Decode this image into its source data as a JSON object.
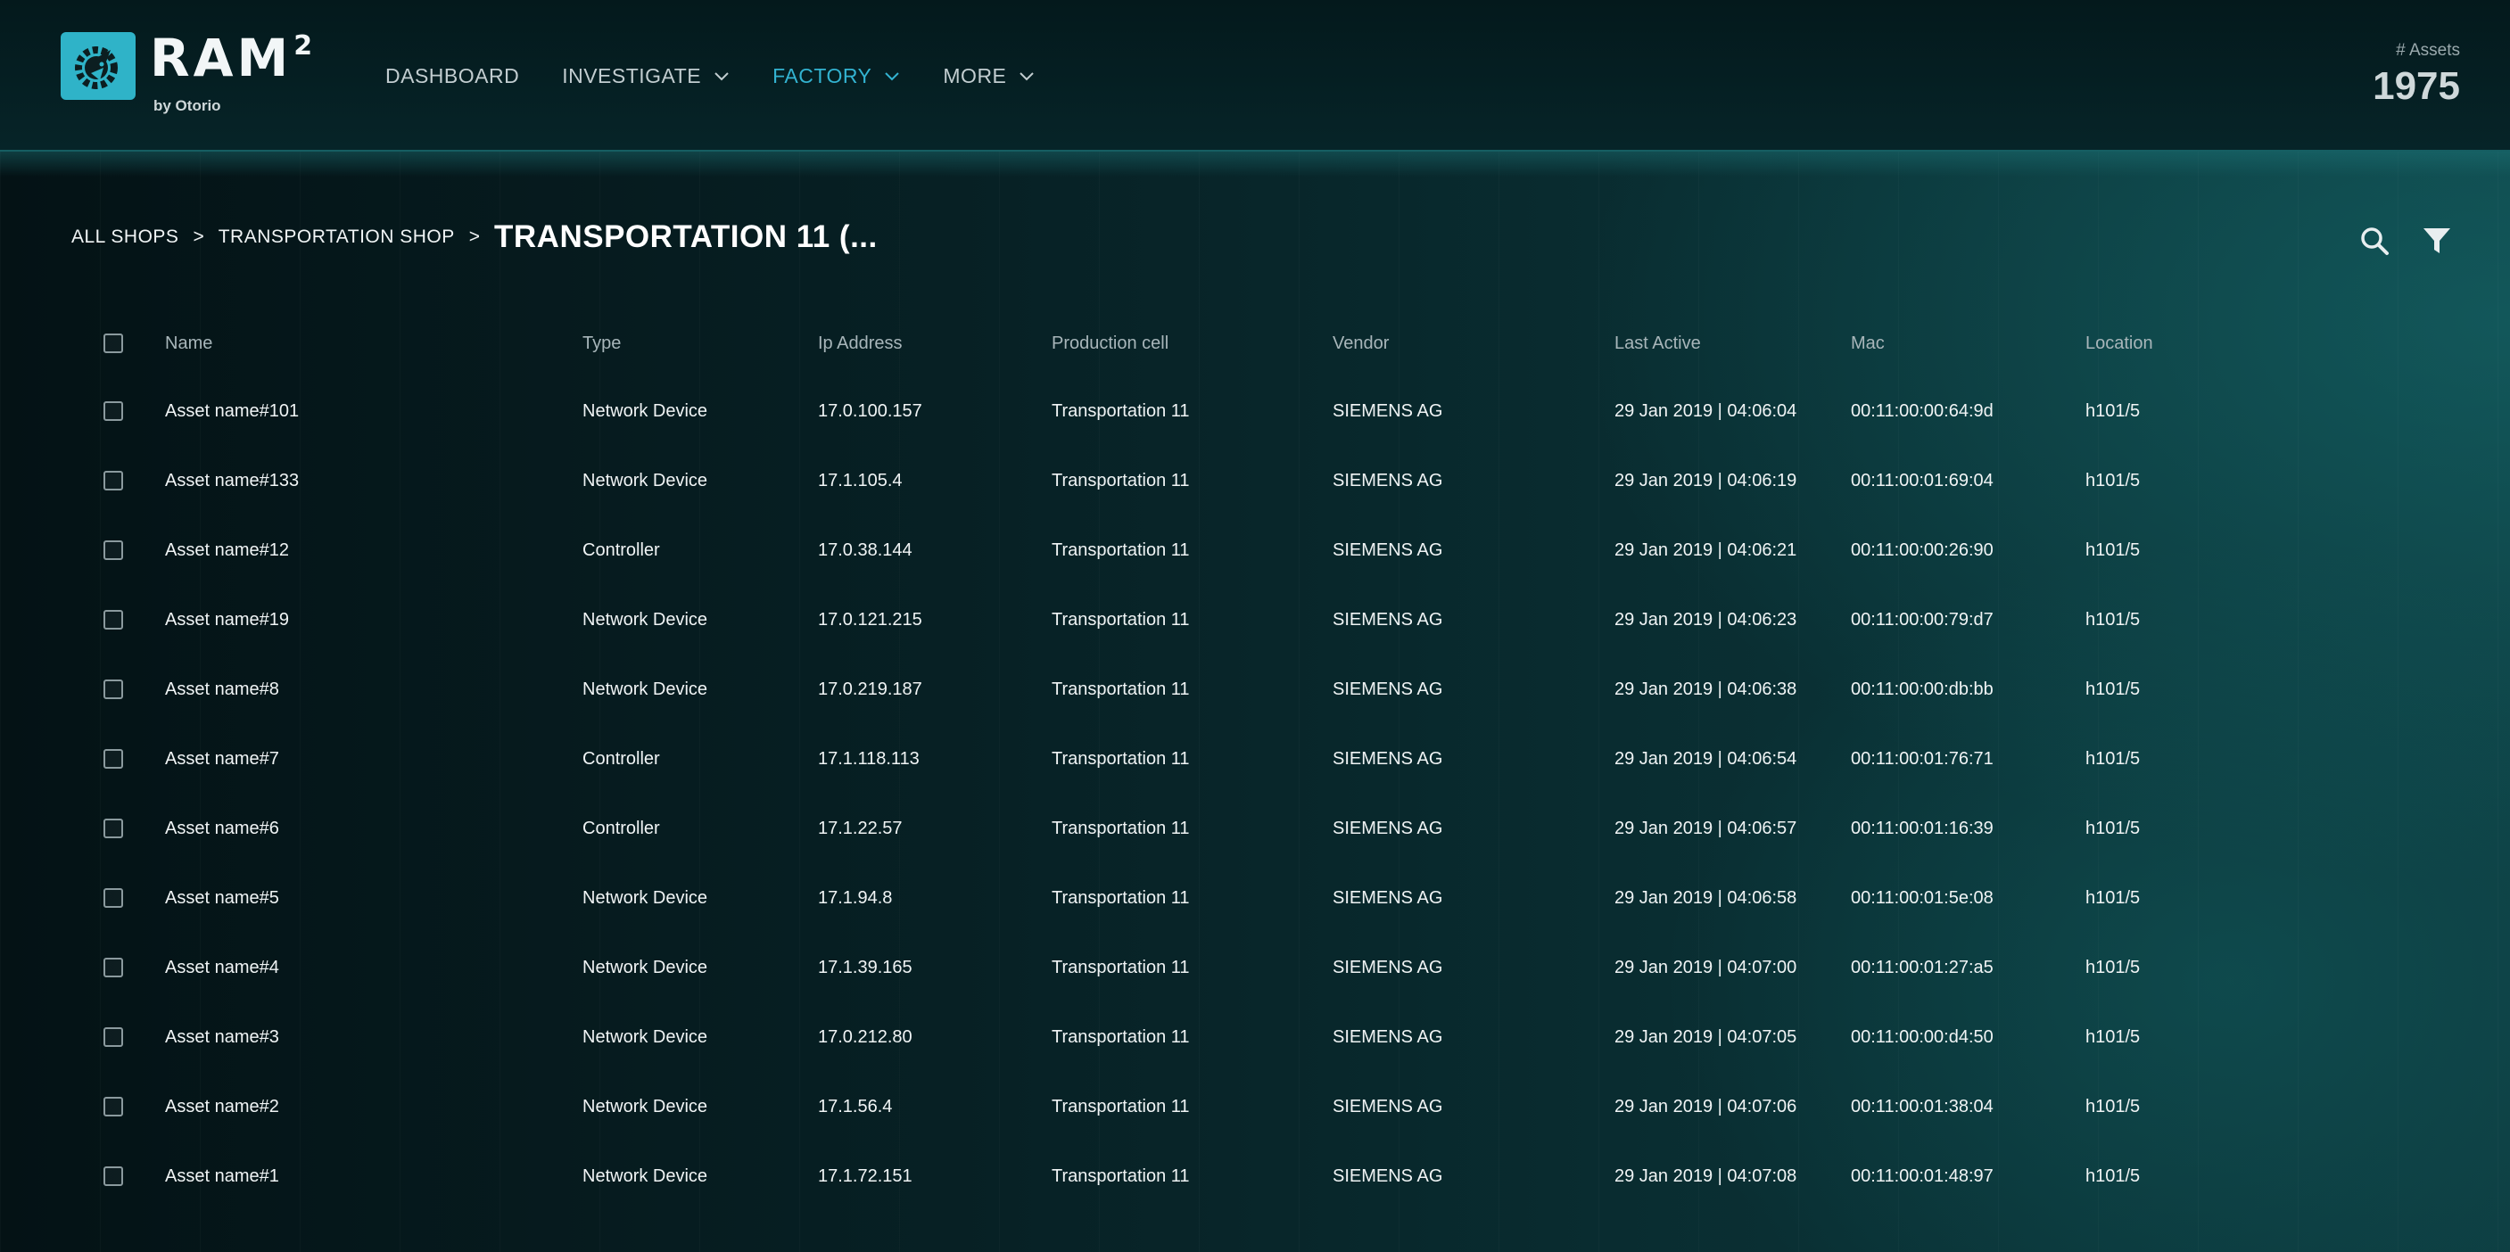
{
  "brand": {
    "name": "RAM",
    "superscript": "2",
    "tagline": "by Otorio"
  },
  "nav": {
    "items": [
      {
        "label": "DASHBOARD"
      },
      {
        "label": "INVESTIGATE"
      },
      {
        "label": "FACTORY"
      },
      {
        "label": "MORE"
      }
    ],
    "active": "FACTORY",
    "active_color": "#33b3d1"
  },
  "assets": {
    "label": "# Assets",
    "count": "1975"
  },
  "breadcrumb": {
    "items": [
      "ALL SHOPS",
      "TRANSPORTATION SHOP"
    ],
    "separator": ">",
    "current": "TRANSPORTATION 11 (..."
  },
  "toolbar": {
    "search_icon": "search-icon",
    "filter_icon": "filter-icon"
  },
  "table": {
    "columns": [
      "Name",
      "Type",
      "Ip Address",
      "Production cell",
      "Vendor",
      "Last Active",
      "Mac",
      "Location"
    ],
    "rows": [
      {
        "name": "Asset name#101",
        "type": "Network Device",
        "ip": "17.0.100.157",
        "cell": "Transportation 11",
        "vendor": "SIEMENS AG",
        "last_active": "29 Jan 2019 | 04:06:04",
        "mac": "00:11:00:00:64:9d",
        "location": "h101/5"
      },
      {
        "name": "Asset name#133",
        "type": "Network Device",
        "ip": "17.1.105.4",
        "cell": "Transportation 11",
        "vendor": "SIEMENS AG",
        "last_active": "29 Jan 2019 | 04:06:19",
        "mac": "00:11:00:01:69:04",
        "location": "h101/5"
      },
      {
        "name": "Asset name#12",
        "type": "Controller",
        "ip": "17.0.38.144",
        "cell": "Transportation 11",
        "vendor": "SIEMENS AG",
        "last_active": "29 Jan 2019 | 04:06:21",
        "mac": "00:11:00:00:26:90",
        "location": "h101/5"
      },
      {
        "name": "Asset name#19",
        "type": "Network Device",
        "ip": "17.0.121.215",
        "cell": "Transportation 11",
        "vendor": "SIEMENS AG",
        "last_active": "29 Jan 2019 | 04:06:23",
        "mac": "00:11:00:00:79:d7",
        "location": "h101/5"
      },
      {
        "name": "Asset name#8",
        "type": "Network Device",
        "ip": "17.0.219.187",
        "cell": "Transportation 11",
        "vendor": "SIEMENS AG",
        "last_active": "29 Jan 2019 | 04:06:38",
        "mac": "00:11:00:00:db:bb",
        "location": "h101/5"
      },
      {
        "name": "Asset name#7",
        "type": "Controller",
        "ip": "17.1.118.113",
        "cell": "Transportation 11",
        "vendor": "SIEMENS AG",
        "last_active": "29 Jan 2019 | 04:06:54",
        "mac": "00:11:00:01:76:71",
        "location": "h101/5"
      },
      {
        "name": "Asset name#6",
        "type": "Controller",
        "ip": "17.1.22.57",
        "cell": "Transportation 11",
        "vendor": "SIEMENS AG",
        "last_active": "29 Jan 2019 | 04:06:57",
        "mac": "00:11:00:01:16:39",
        "location": "h101/5"
      },
      {
        "name": "Asset name#5",
        "type": "Network Device",
        "ip": "17.1.94.8",
        "cell": "Transportation 11",
        "vendor": "SIEMENS AG",
        "last_active": "29 Jan 2019 | 04:06:58",
        "mac": "00:11:00:01:5e:08",
        "location": "h101/5"
      },
      {
        "name": "Asset name#4",
        "type": "Network Device",
        "ip": "17.1.39.165",
        "cell": "Transportation 11",
        "vendor": "SIEMENS AG",
        "last_active": "29 Jan 2019 | 04:07:00",
        "mac": "00:11:00:01:27:a5",
        "location": "h101/5"
      },
      {
        "name": "Asset name#3",
        "type": "Network Device",
        "ip": "17.0.212.80",
        "cell": "Transportation 11",
        "vendor": "SIEMENS AG",
        "last_active": "29 Jan 2019 | 04:07:05",
        "mac": "00:11:00:00:d4:50",
        "location": "h101/5"
      },
      {
        "name": "Asset name#2",
        "type": "Network Device",
        "ip": "17.1.56.4",
        "cell": "Transportation 11",
        "vendor": "SIEMENS AG",
        "last_active": "29 Jan 2019 | 04:07:06",
        "mac": "00:11:00:01:38:04",
        "location": "h101/5"
      },
      {
        "name": "Asset name#1",
        "type": "Network Device",
        "ip": "17.1.72.151",
        "cell": "Transportation 11",
        "vendor": "SIEMENS AG",
        "last_active": "29 Jan 2019 | 04:07:08",
        "mac": "00:11:00:01:48:97",
        "location": "h101/5"
      }
    ]
  },
  "colors": {
    "accent": "#33b3d1",
    "logo_bg": "#2fb3c8",
    "background": "#06191c"
  }
}
